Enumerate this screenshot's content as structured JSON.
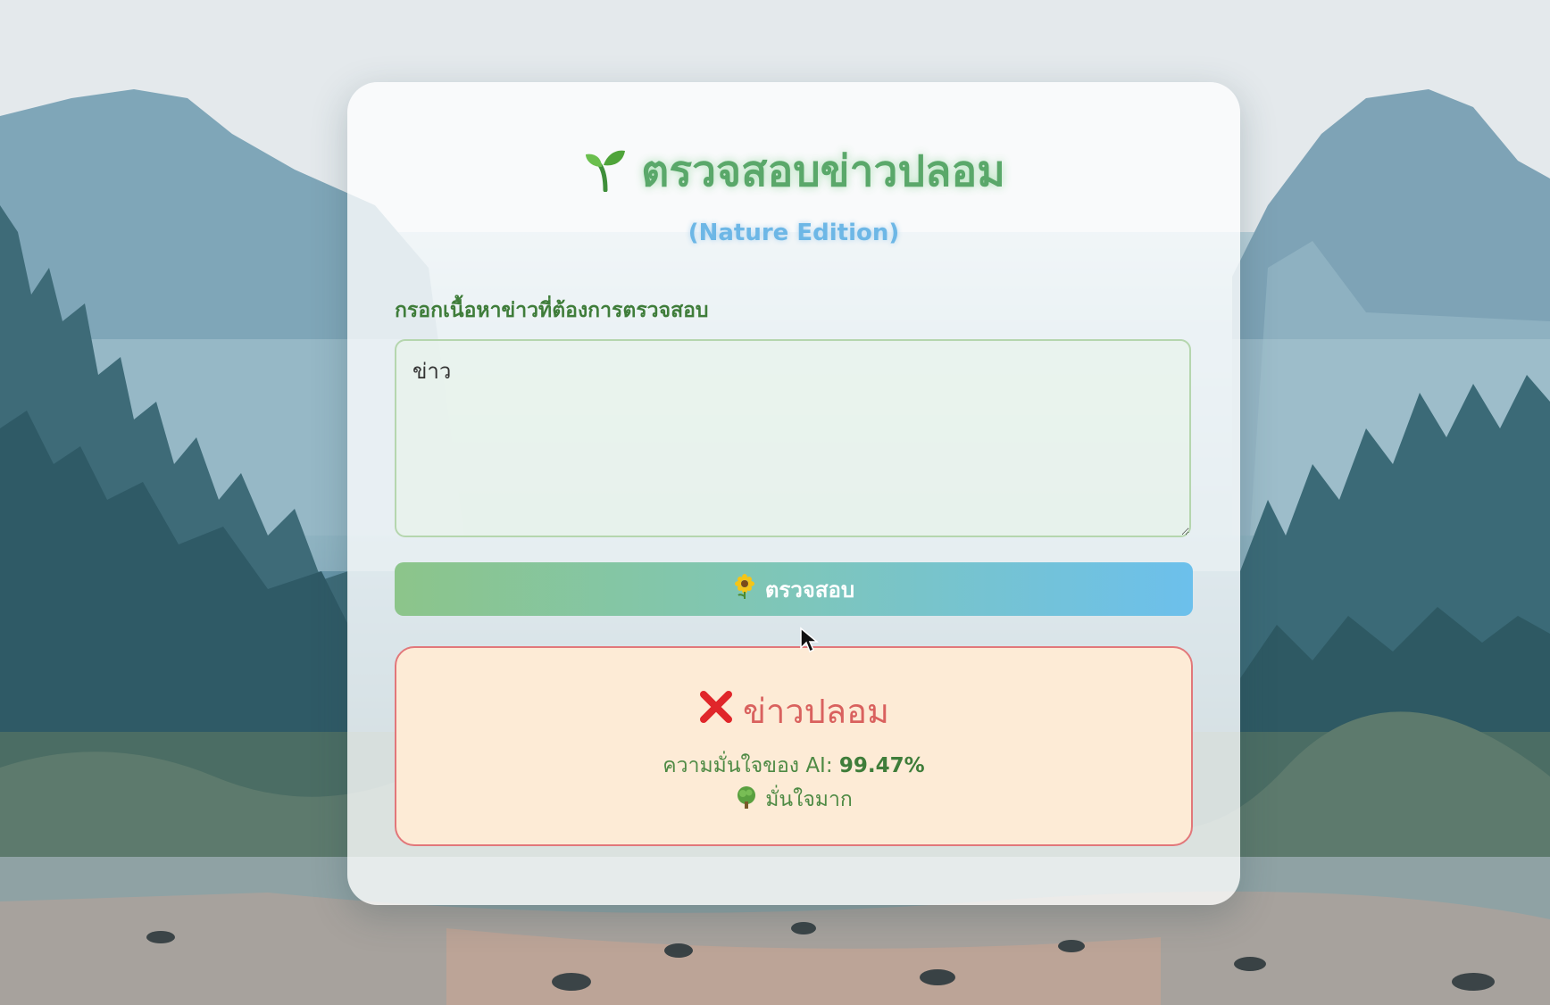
{
  "app": {
    "title": "ตรวจสอบข่าวปลอม",
    "subtitle": "(Nature Edition)",
    "title_icon": "sprout-icon"
  },
  "form": {
    "label": "กรอกเนื้อหาข่าวที่ต้องการตรวจสอบ",
    "input_value": "ข่าว",
    "submit_label": "ตรวจสอบ",
    "submit_icon": "sunflower-icon"
  },
  "result": {
    "verdict": "ข่าวปลอม",
    "verdict_icon": "cross-mark-icon",
    "confidence_label": "ความมั่นใจของ AI:",
    "confidence_value": "99.47%",
    "confidence_level": "มั่นใจมาก",
    "level_icon": "tree-icon"
  },
  "colors": {
    "title": "#5aa86a",
    "subtitle": "#6db7e6",
    "label": "#3f7d3a",
    "button_start": "#8cc58a",
    "button_end": "#6cc0ec",
    "result_border": "#e2777a",
    "result_bg": "#fdebd6",
    "verdict": "#d9615e"
  }
}
